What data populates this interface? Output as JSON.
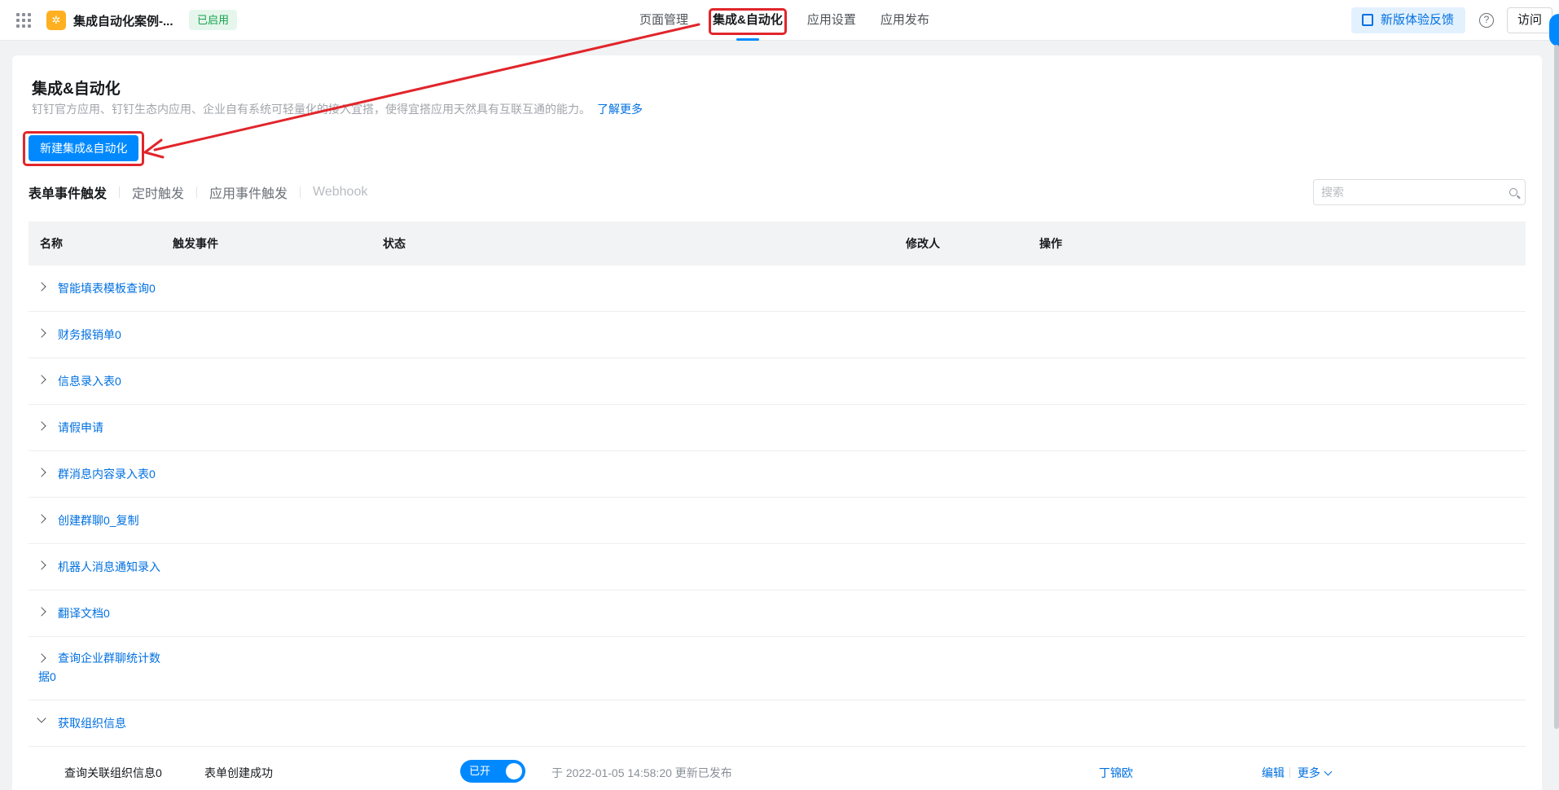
{
  "header": {
    "app_logo_glyph": "✲",
    "app_name": "集成自动化案例-...",
    "app_status": "已启用",
    "nav": [
      "页面管理",
      "集成&自动化",
      "应用设置",
      "应用发布"
    ],
    "active_nav": "集成&自动化",
    "feedback_label": "新版体验反馈",
    "help_glyph": "?",
    "visit_label": "访问"
  },
  "page": {
    "title": "集成&自动化",
    "description": "钉钉官方应用、钉钉生态内应用、企业自有系统可轻量化的接入宜搭，使得宜搭应用天然具有互联互通的能力。",
    "learn_more": "了解更多",
    "new_button": "新建集成&自动化"
  },
  "tabs": [
    "表单事件触发",
    "定时触发",
    "应用事件触发",
    "Webhook"
  ],
  "active_tab": "表单事件触发",
  "search": {
    "placeholder": "搜索"
  },
  "table": {
    "columns": [
      "名称",
      "触发事件",
      "状态",
      "修改人",
      "操作"
    ],
    "groups": [
      "智能填表模板查询0",
      "财务报销单0",
      "信息录入表0",
      "请假申请",
      "群消息内容录入表0",
      "创建群聊0_复制",
      "机器人消息通知录入",
      "翻译文档0",
      "查询企业群聊统计数据0"
    ],
    "expanded_group": "获取组织信息",
    "sub_row": {
      "name": "查询关联组织信息0",
      "event": "表单创建成功",
      "status": "已开",
      "time": "于 2022-01-05 14:58:20 更新已发布",
      "modifier": "丁锦欧",
      "edit": "编辑",
      "more": "更多"
    }
  },
  "colors": {
    "accent": "#0089ff",
    "link": "#0070e0",
    "annotation": "#e1252b"
  }
}
